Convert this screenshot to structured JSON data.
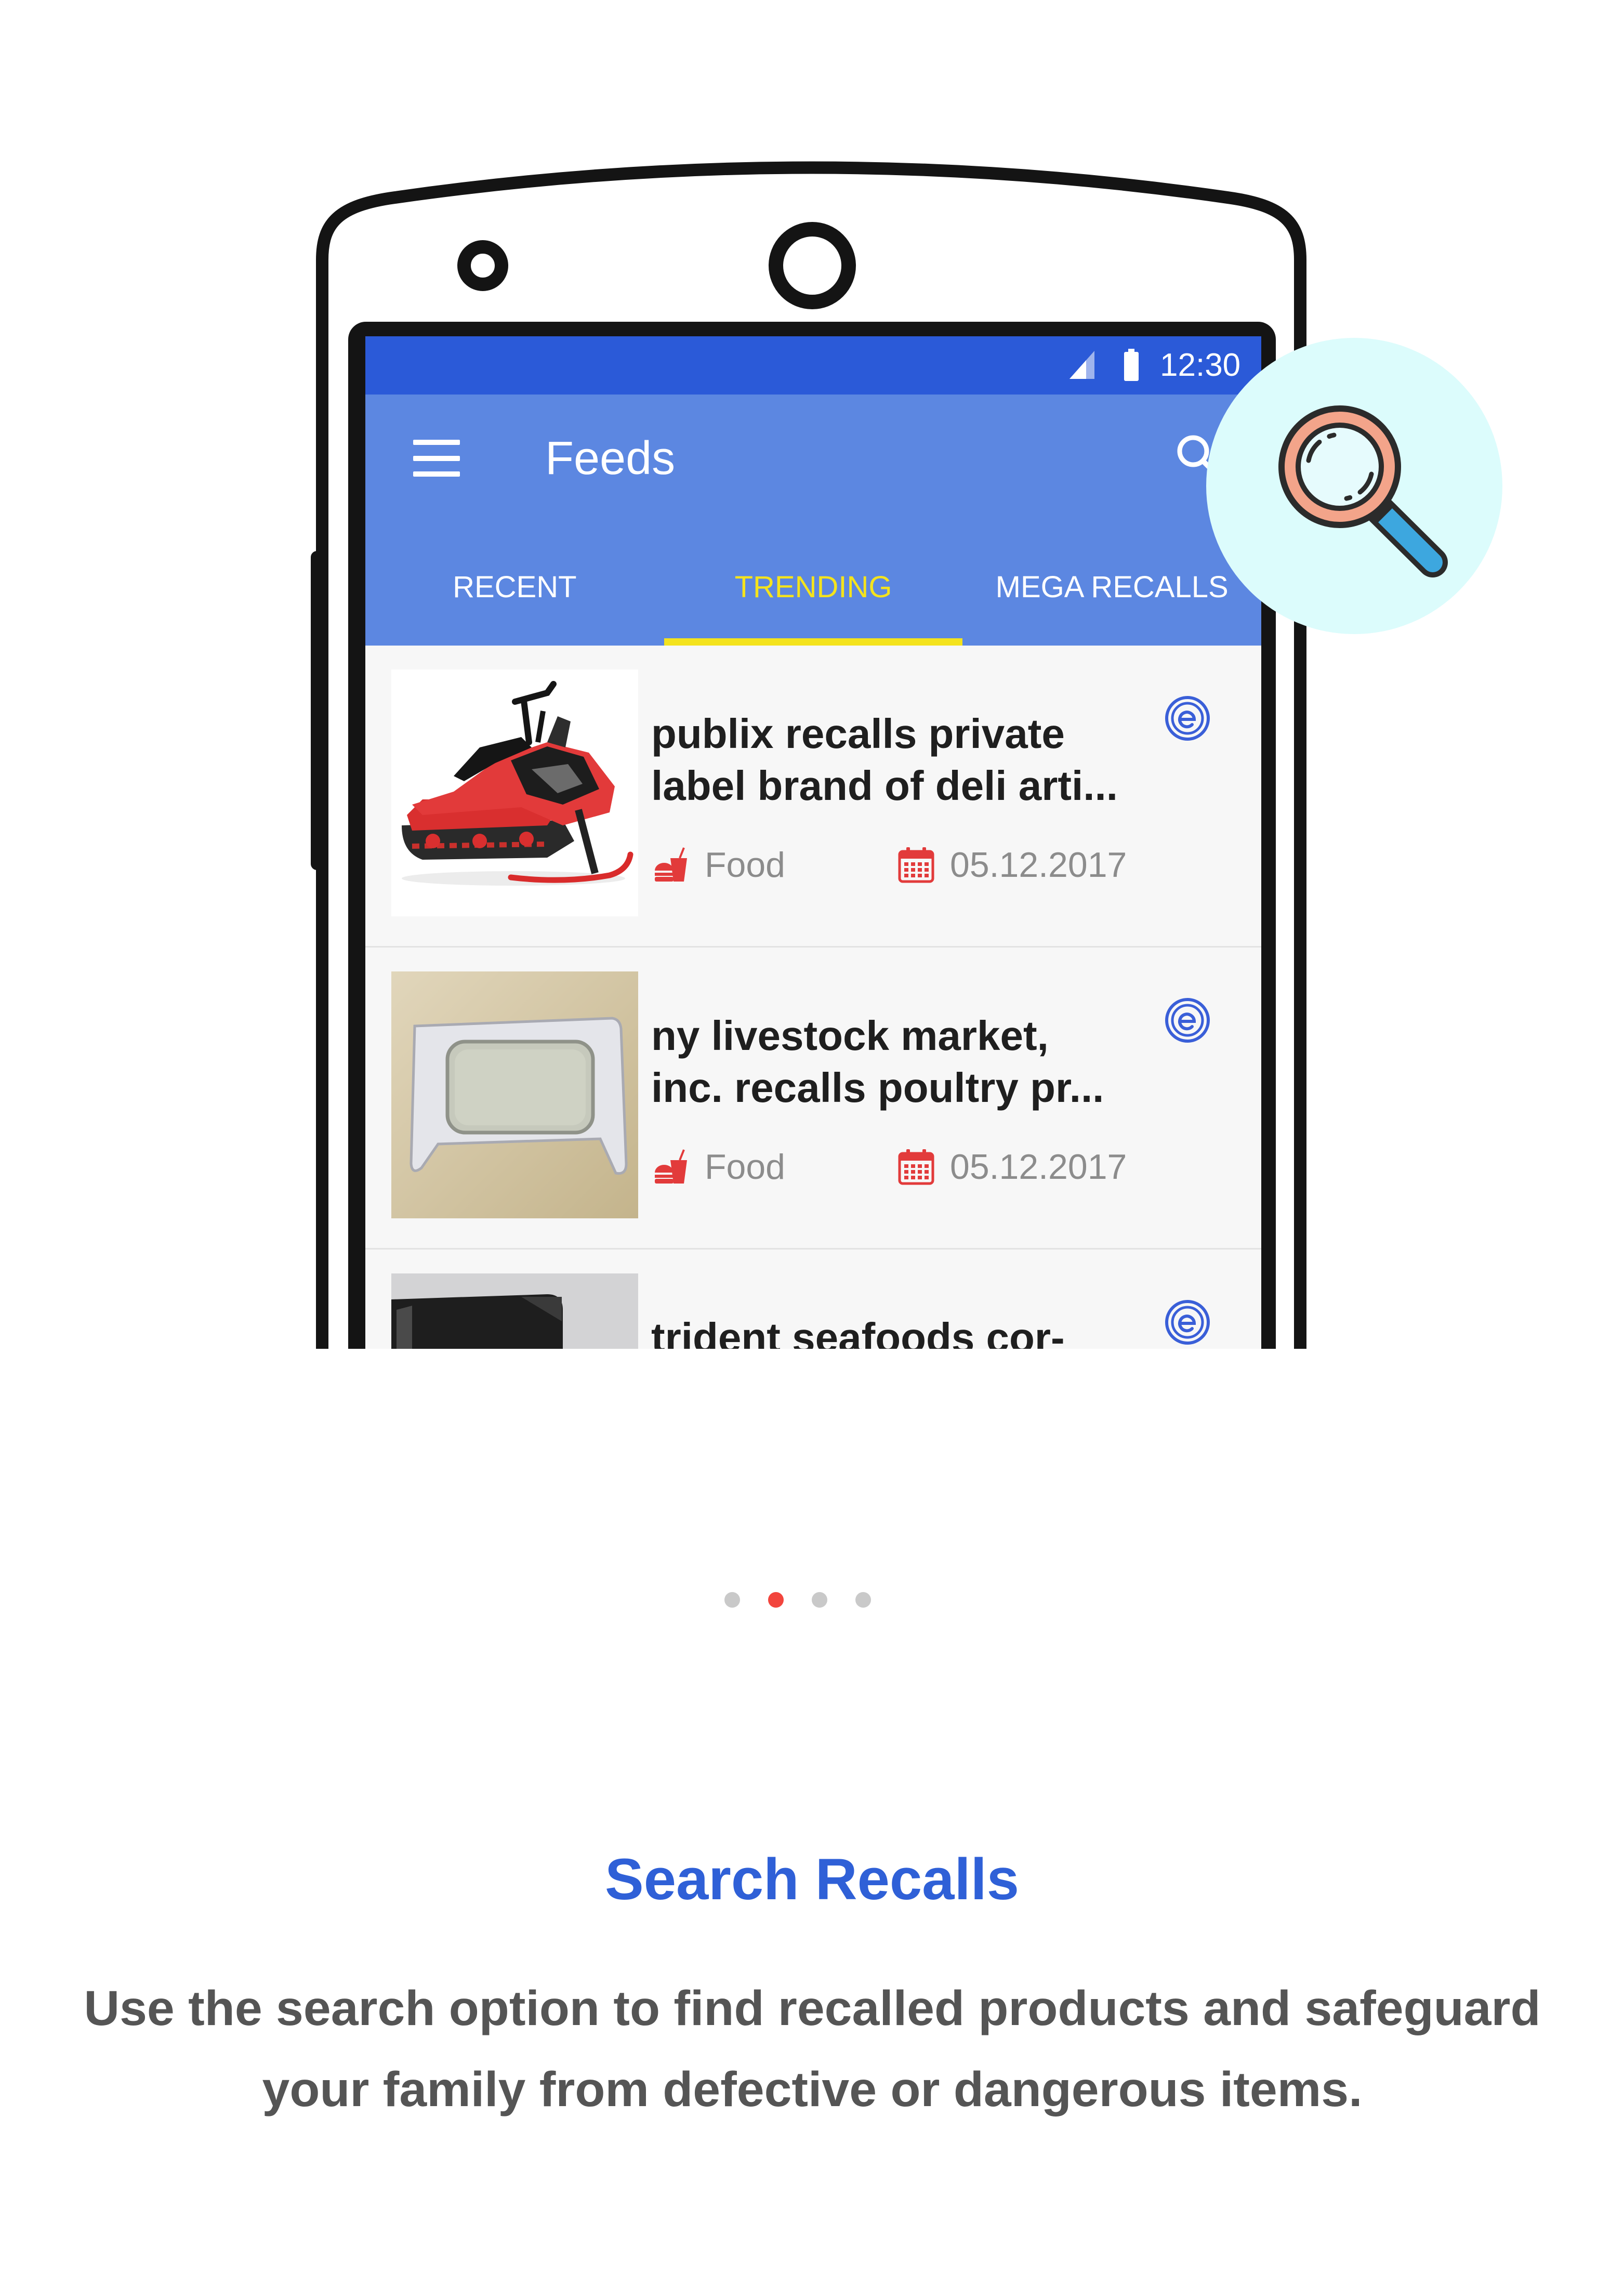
{
  "status_bar": {
    "time": "12:30",
    "signal_icon": "signal-icon",
    "battery_icon": "battery-icon"
  },
  "app_bar": {
    "title": "Feeds",
    "menu_icon": "hamburger-menu-icon",
    "search_icon": "search-icon"
  },
  "tabs": [
    {
      "label": "RECENT",
      "active": false
    },
    {
      "label": "TRENDING",
      "active": true
    },
    {
      "label": "MEGA RECALLS",
      "active": false
    }
  ],
  "feed_items": [
    {
      "title_lines": [
        "publix recalls private",
        "label brand of deli arti..."
      ],
      "category": "Food",
      "category_icon": "food-icon",
      "date": "05.12.2017",
      "date_icon": "calendar-icon",
      "source_icon": "source-logo-icon"
    },
    {
      "title_lines": [
        "ny livestock market,",
        "inc. recalls poultry pr..."
      ],
      "category": "Food",
      "category_icon": "food-icon",
      "date": "05.12.2017",
      "date_icon": "calendar-icon",
      "source_icon": "source-logo-icon"
    },
    {
      "title_lines": [
        "trident seafoods cor-"
      ],
      "source_icon": "source-logo-icon"
    }
  ],
  "feature_badge": {
    "icon": "magnifying-glass-icon"
  },
  "pager": {
    "page_count": 4,
    "active_index": 1
  },
  "caption": {
    "title": "Search Recalls",
    "body": "Use the search option to find recalled products and safeguard your family from defective or dangerous items."
  },
  "colors": {
    "status_bar": "#2b5ad8",
    "app_bar": "#5c87e1",
    "active_tab": "#f4e31d",
    "caption_title": "#2f60d7",
    "caption_body": "#555555",
    "badge_background": "#dcfcfc",
    "pager_active": "#f2453d",
    "pager_inactive": "#c9c9c9",
    "meta_icons": "#e23b3b",
    "source_icon": "#3a5fd8"
  }
}
